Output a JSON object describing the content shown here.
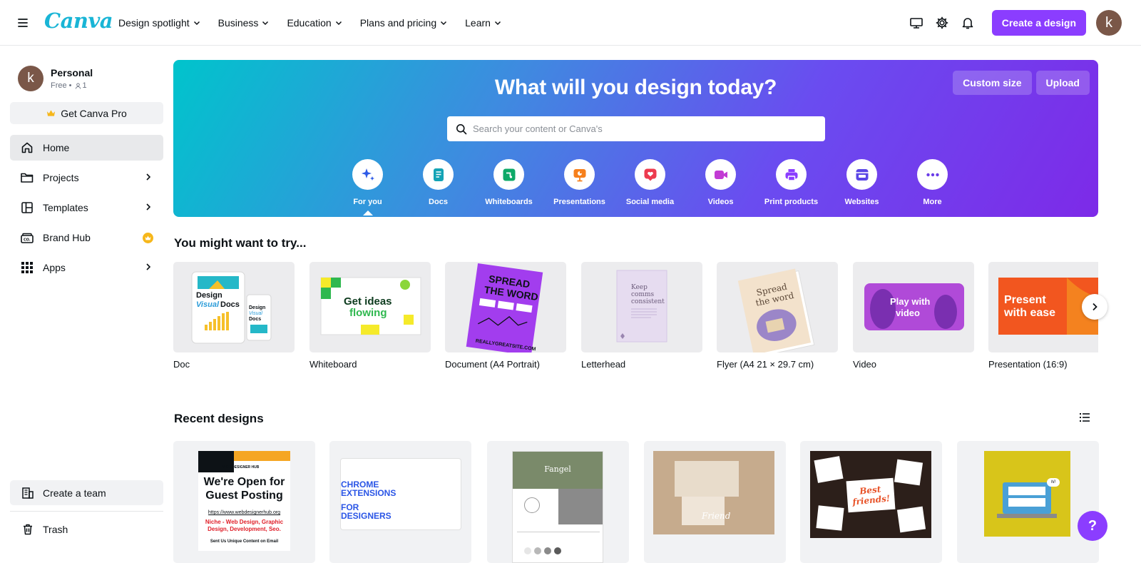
{
  "brand": {
    "logo": "Canva",
    "accent": "#8b3dff"
  },
  "topnav": [
    {
      "label": "Design spotlight"
    },
    {
      "label": "Business"
    },
    {
      "label": "Education"
    },
    {
      "label": "Plans and pricing"
    },
    {
      "label": "Learn"
    }
  ],
  "header": {
    "create_label": "Create a design",
    "avatar_letter": "k"
  },
  "account": {
    "avatar_letter": "k",
    "name": "Personal",
    "plan": "Free •",
    "members": "1"
  },
  "sidebar": {
    "pro_label": "Get Canva Pro",
    "items": [
      {
        "label": "Home",
        "icon": "home-icon"
      },
      {
        "label": "Projects",
        "icon": "folder-icon"
      },
      {
        "label": "Templates",
        "icon": "templates-icon"
      },
      {
        "label": "Brand Hub",
        "icon": "brand-hub-icon"
      },
      {
        "label": "Apps",
        "icon": "apps-icon"
      }
    ],
    "team_label": "Create a team",
    "trash_label": "Trash"
  },
  "hero": {
    "title": "What will you design today?",
    "custom_size_label": "Custom size",
    "upload_label": "Upload",
    "search_placeholder": "Search your content or Canva's",
    "categories": [
      {
        "label": "For you",
        "icon": "sparkle-icon",
        "color": "#2f5be7"
      },
      {
        "label": "Docs",
        "icon": "doc-icon",
        "color": "#13a3b5"
      },
      {
        "label": "Whiteboards",
        "icon": "whiteboard-icon",
        "color": "#0ea968"
      },
      {
        "label": "Presentations",
        "icon": "presentation-icon",
        "color": "#f6801d"
      },
      {
        "label": "Social media",
        "icon": "heart-icon",
        "color": "#ed3b4f"
      },
      {
        "label": "Videos",
        "icon": "video-icon",
        "color": "#c23bd4"
      },
      {
        "label": "Print products",
        "icon": "print-icon",
        "color": "#8b3dff"
      },
      {
        "label": "Websites",
        "icon": "website-icon",
        "color": "#5a46e6"
      },
      {
        "label": "More",
        "icon": "more-icon",
        "color": "#6b3de8"
      }
    ]
  },
  "try_section": {
    "title": "You might want to try...",
    "cards": [
      {
        "label": "Doc",
        "thumb_text": "Design Visual Docs"
      },
      {
        "label": "Whiteboard",
        "thumb_text": "Get ideas flowing"
      },
      {
        "label": "Document (A4 Portrait)",
        "thumb_text": "SPREAD THE WORD"
      },
      {
        "label": "Letterhead",
        "thumb_text": "Keep comms consistent"
      },
      {
        "label": "Flyer (A4 21 × 29.7 cm)",
        "thumb_text": "Spread the word"
      },
      {
        "label": "Video",
        "thumb_text": "Play with video"
      },
      {
        "label": "Presentation (16:9)",
        "thumb_text": "Present with ease"
      }
    ]
  },
  "recent_section": {
    "title": "Recent designs",
    "cards": [
      {
        "line1": "We're Open for",
        "line2": "Guest Posting",
        "sub": "Niche - Web Design, Graphic Design, Development, Seo.",
        "footer": "Sent Us Unique Content on Email",
        "hub": "WEB DESIGNER HUB",
        "url": "https://www.webdesignerhub.org"
      },
      {
        "line1": "CHROME",
        "line2": "EXTENSIONS",
        "line3": "FOR",
        "line4": "DESIGNERS"
      },
      {
        "title": "Fangel"
      },
      {
        "title": "Friend"
      },
      {
        "title": "Best friends!"
      },
      {
        "title": "hi!"
      }
    ]
  },
  "help_label": "?"
}
